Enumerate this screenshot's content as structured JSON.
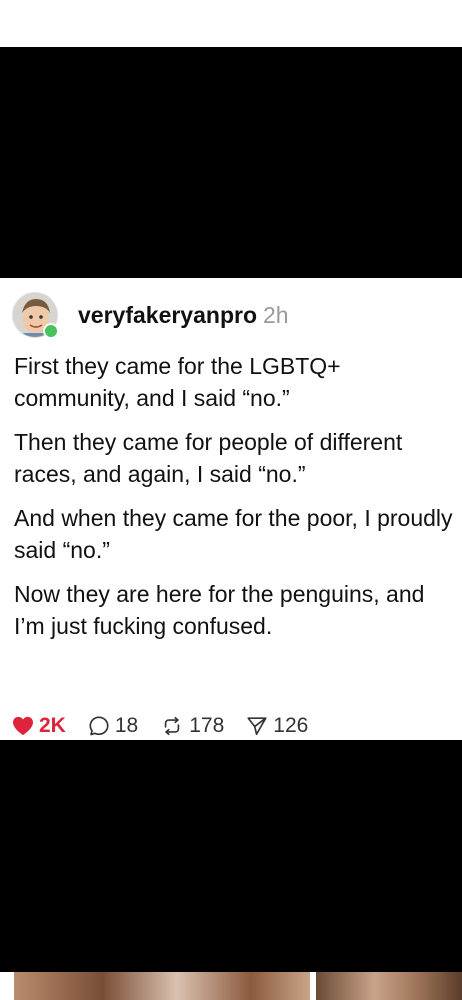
{
  "post": {
    "username": "veryfakeryanpro",
    "time": "2h",
    "paragraphs": [
      "First they came for the LGBTQ+ community, and I said “no.”",
      "Then they came for people of different races, and again, I said “no.”",
      "And when they came for the poor, I proudly said “no.”",
      "Now they are here for the penguins, and I’m just fucking confused."
    ],
    "actions": {
      "likes": "2K",
      "replies": "18",
      "reposts": "178",
      "shares": "126"
    }
  },
  "icons": {
    "like": "heart-icon",
    "reply": "speech-bubble-icon",
    "repost": "repost-arrows-icon",
    "share": "send-icon"
  },
  "colors": {
    "liked": "#e0233c",
    "online": "#46c35d",
    "timestamp": "#9a9a9a"
  }
}
